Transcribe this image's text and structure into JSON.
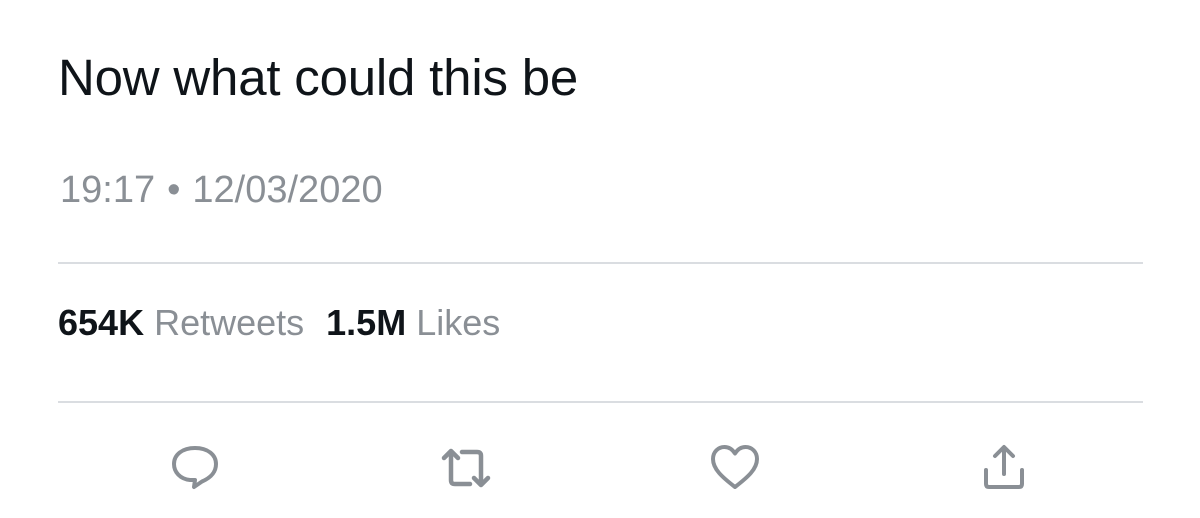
{
  "tweet": {
    "text": "Now what could this be",
    "time": "19:17",
    "separator": "•",
    "date": "12/03/2020"
  },
  "stats": {
    "retweets_count": "654K",
    "retweets_label": "Retweets",
    "likes_count": "1.5M",
    "likes_label": "Likes"
  },
  "actions": {
    "reply_icon": "reply-icon",
    "retweet_icon": "retweet-icon",
    "like_icon": "heart-icon",
    "share_icon": "share-icon",
    "icon_color": "#8a8f95"
  }
}
